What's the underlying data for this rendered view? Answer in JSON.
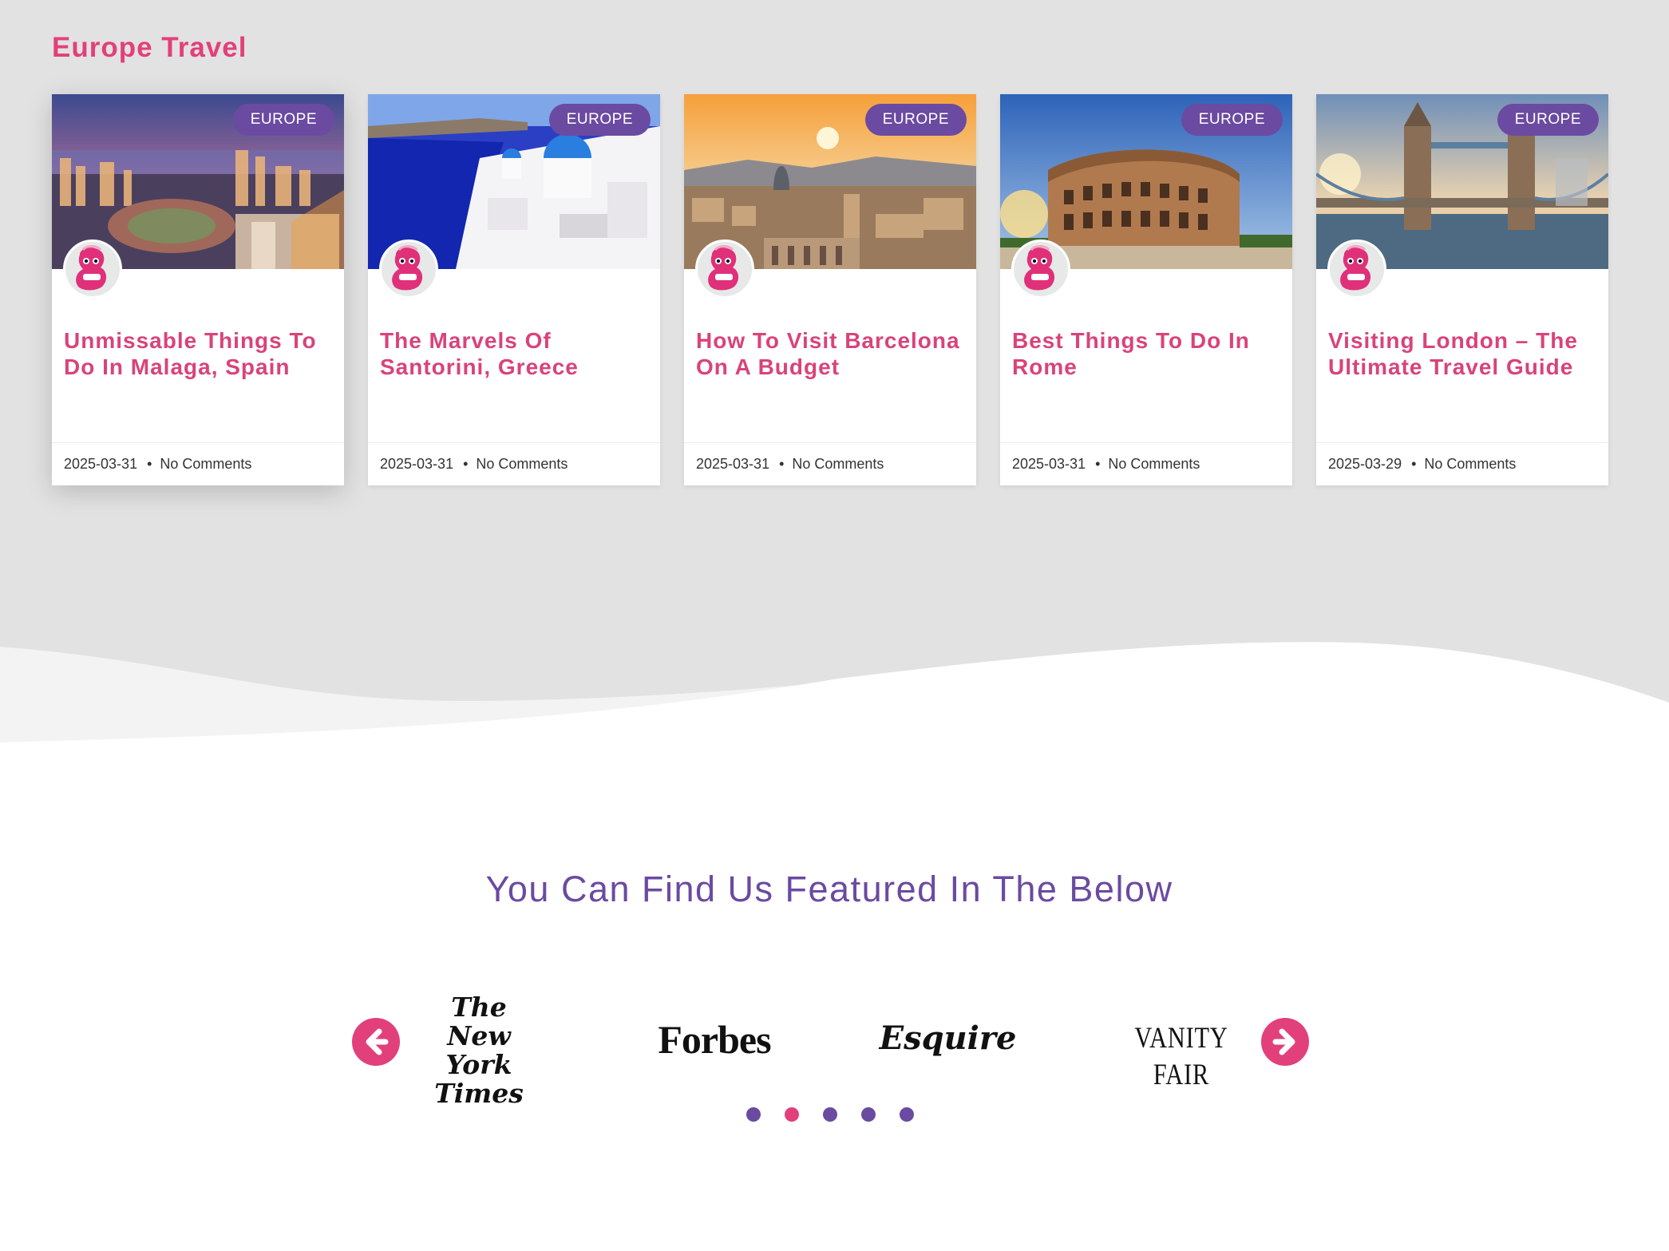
{
  "section": {
    "title": "Europe Travel"
  },
  "cards": [
    {
      "category": "EUROPE",
      "title": "Unmissable Things To Do In Malaga, Spain",
      "date": "2025-03-31",
      "comments": "No Comments"
    },
    {
      "category": "EUROPE",
      "title": "The Marvels Of Santorini, Greece",
      "date": "2025-03-31",
      "comments": "No Comments"
    },
    {
      "category": "EUROPE",
      "title": "How To Visit Barcelona On A Budget",
      "date": "2025-03-31",
      "comments": "No Comments"
    },
    {
      "category": "EUROPE",
      "title": "Best Things To Do In Rome",
      "date": "2025-03-31",
      "comments": "No Comments"
    },
    {
      "category": "EUROPE",
      "title": "Visiting London – The Ultimate Travel Guide",
      "date": "2025-03-29",
      "comments": "No Comments"
    }
  ],
  "featured": {
    "title": "You Can Find Us Featured In The Below",
    "logos": [
      {
        "name": "The New York Times",
        "line1": "The",
        "line2": "New York",
        "line3": "Times"
      },
      {
        "name": "Forbes",
        "text": "Forbes"
      },
      {
        "name": "Esquire",
        "text": "Esquire"
      },
      {
        "name": "Vanity Fair",
        "text": "VANITY FAIR"
      }
    ],
    "carousel": {
      "prev_icon": "arrow-left-icon",
      "next_icon": "arrow-right-icon",
      "slides": 5,
      "active_slide": 2
    }
  },
  "colors": {
    "accent_pink": "#e2407a",
    "accent_purple": "#6b4aa1",
    "page_grey": "#e2e2e2"
  }
}
